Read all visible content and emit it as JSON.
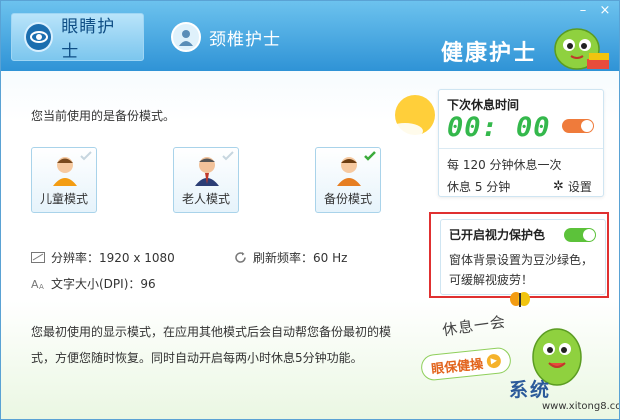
{
  "header": {
    "tabs": [
      {
        "label": "眼睛护士",
        "icon": "eye-nurse-icon"
      },
      {
        "label": "颈椎护士",
        "icon": "cervical-nurse-icon"
      }
    ],
    "brand": "健康护士",
    "window_controls": {
      "minimize": "–",
      "close": "×"
    }
  },
  "left": {
    "mode_text": "您当前使用的是备份模式。",
    "modes": [
      {
        "label": "儿童模式",
        "icon": "child-avatar-icon",
        "selected": false
      },
      {
        "label": "老人模式",
        "icon": "elder-avatar-icon",
        "selected": false
      },
      {
        "label": "备份模式",
        "icon": "backup-avatar-icon",
        "selected": true
      }
    ],
    "resolution": "分辨率：1920 x 1080",
    "refresh_rate": "刷新频率：60 Hz",
    "font_size": "文字大小(DPI)：96",
    "description": "您最初使用的显示模式，在应用其他模式后会自动帮您备份最初的模式，方便您随时恢复。同时自动开启每两小时休息5分钟功能。"
  },
  "break_panel": {
    "title": "下次休息时间",
    "timer": "00: 00",
    "interval": "每 120 分钟休息一次",
    "duration": "休息 5 分钟",
    "settings_label": "设置"
  },
  "eye_panel": {
    "title": "已开启视力保护色",
    "description": "窗体背景设置为豆沙绿色，可缓解视疲劳！",
    "enabled": true
  },
  "rest_label": "休息一会",
  "health_button": "眼保健操",
  "watermark": {
    "text": "系统",
    "url": "www.xitong8.com"
  },
  "colors": {
    "header_blue": "#2f93d6",
    "timer_green": "#34b84c",
    "toggle_orange": "#ef7b3b",
    "toggle_green": "#5cc23a",
    "highlight_red": "#e03030"
  }
}
